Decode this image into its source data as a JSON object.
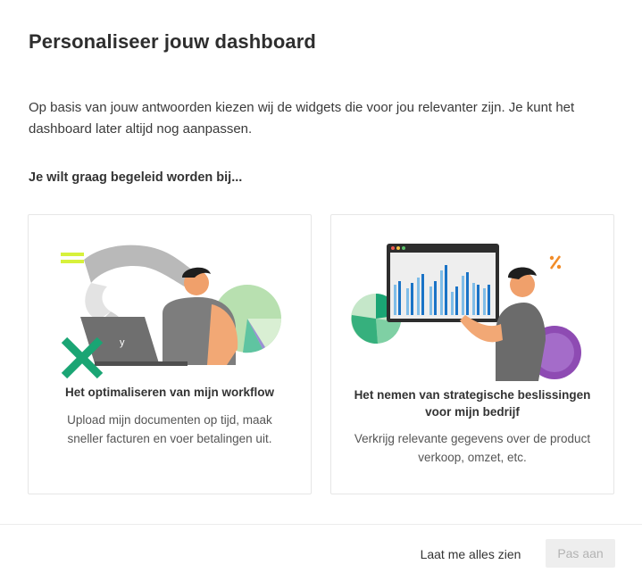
{
  "header": {
    "title": "Personaliseer jouw dashboard",
    "intro": "Op basis van jouw antwoorden kiezen wij de widgets die voor jou relevanter zijn. Je kunt het dashboard later altijd nog aanpassen."
  },
  "question": "Je wilt graag begeleid worden bij...",
  "options": [
    {
      "title": "Het optimaliseren van mijn workflow",
      "description": "Upload mijn documenten op tijd, maak sneller facturen en voer betalingen uit.",
      "illustration": "person-with-laptop-illustration"
    },
    {
      "title": "Het nemen van strategische beslissingen voor mijn bedrijf",
      "description": "Verkrijg relevante gegevens over de product verkoop, omzet, etc.",
      "illustration": "person-with-chart-board-illustration"
    }
  ],
  "laptop_logo": "y",
  "footer": {
    "secondary_label": "Laat me alles zien",
    "primary_label": "Pas aan"
  },
  "colors": {
    "accent_green": "#1aa574",
    "accent_yellow": "#d7f13b",
    "accent_orange": "#f28c28",
    "accent_purple": "#8e4bb3",
    "disabled_button_bg": "#eeeeee",
    "disabled_button_text": "#b3b3b3"
  }
}
